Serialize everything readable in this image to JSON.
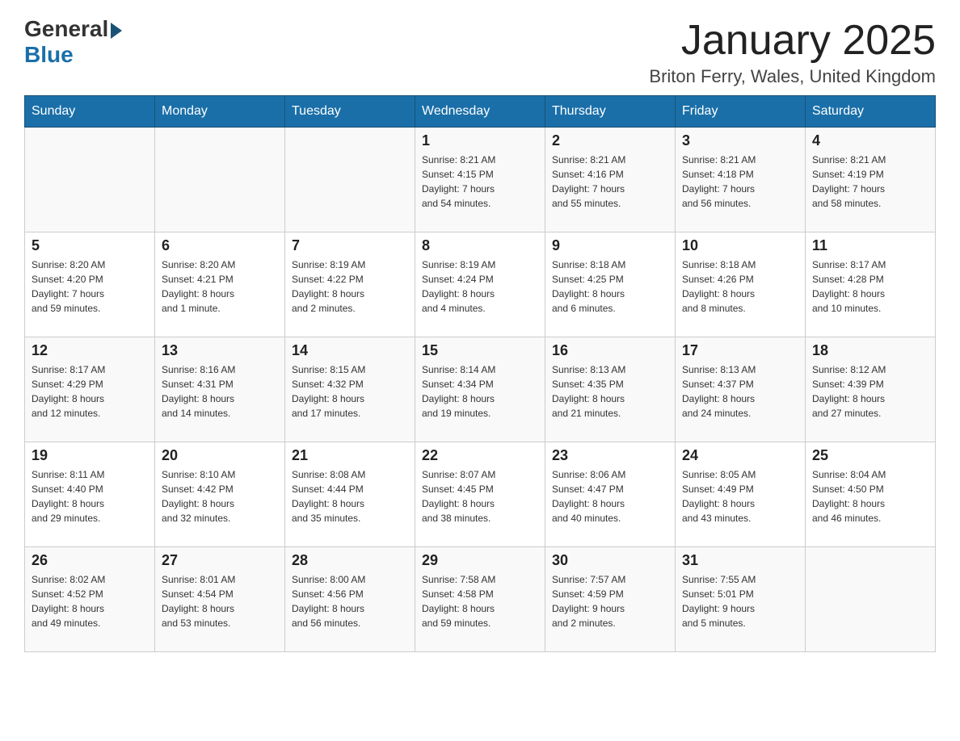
{
  "header": {
    "logo_general": "General",
    "logo_blue": "Blue",
    "title": "January 2025",
    "subtitle": "Briton Ferry, Wales, United Kingdom"
  },
  "days_of_week": [
    "Sunday",
    "Monday",
    "Tuesday",
    "Wednesday",
    "Thursday",
    "Friday",
    "Saturday"
  ],
  "weeks": [
    [
      {
        "day": "",
        "info": ""
      },
      {
        "day": "",
        "info": ""
      },
      {
        "day": "",
        "info": ""
      },
      {
        "day": "1",
        "info": "Sunrise: 8:21 AM\nSunset: 4:15 PM\nDaylight: 7 hours\nand 54 minutes."
      },
      {
        "day": "2",
        "info": "Sunrise: 8:21 AM\nSunset: 4:16 PM\nDaylight: 7 hours\nand 55 minutes."
      },
      {
        "day": "3",
        "info": "Sunrise: 8:21 AM\nSunset: 4:18 PM\nDaylight: 7 hours\nand 56 minutes."
      },
      {
        "day": "4",
        "info": "Sunrise: 8:21 AM\nSunset: 4:19 PM\nDaylight: 7 hours\nand 58 minutes."
      }
    ],
    [
      {
        "day": "5",
        "info": "Sunrise: 8:20 AM\nSunset: 4:20 PM\nDaylight: 7 hours\nand 59 minutes."
      },
      {
        "day": "6",
        "info": "Sunrise: 8:20 AM\nSunset: 4:21 PM\nDaylight: 8 hours\nand 1 minute."
      },
      {
        "day": "7",
        "info": "Sunrise: 8:19 AM\nSunset: 4:22 PM\nDaylight: 8 hours\nand 2 minutes."
      },
      {
        "day": "8",
        "info": "Sunrise: 8:19 AM\nSunset: 4:24 PM\nDaylight: 8 hours\nand 4 minutes."
      },
      {
        "day": "9",
        "info": "Sunrise: 8:18 AM\nSunset: 4:25 PM\nDaylight: 8 hours\nand 6 minutes."
      },
      {
        "day": "10",
        "info": "Sunrise: 8:18 AM\nSunset: 4:26 PM\nDaylight: 8 hours\nand 8 minutes."
      },
      {
        "day": "11",
        "info": "Sunrise: 8:17 AM\nSunset: 4:28 PM\nDaylight: 8 hours\nand 10 minutes."
      }
    ],
    [
      {
        "day": "12",
        "info": "Sunrise: 8:17 AM\nSunset: 4:29 PM\nDaylight: 8 hours\nand 12 minutes."
      },
      {
        "day": "13",
        "info": "Sunrise: 8:16 AM\nSunset: 4:31 PM\nDaylight: 8 hours\nand 14 minutes."
      },
      {
        "day": "14",
        "info": "Sunrise: 8:15 AM\nSunset: 4:32 PM\nDaylight: 8 hours\nand 17 minutes."
      },
      {
        "day": "15",
        "info": "Sunrise: 8:14 AM\nSunset: 4:34 PM\nDaylight: 8 hours\nand 19 minutes."
      },
      {
        "day": "16",
        "info": "Sunrise: 8:13 AM\nSunset: 4:35 PM\nDaylight: 8 hours\nand 21 minutes."
      },
      {
        "day": "17",
        "info": "Sunrise: 8:13 AM\nSunset: 4:37 PM\nDaylight: 8 hours\nand 24 minutes."
      },
      {
        "day": "18",
        "info": "Sunrise: 8:12 AM\nSunset: 4:39 PM\nDaylight: 8 hours\nand 27 minutes."
      }
    ],
    [
      {
        "day": "19",
        "info": "Sunrise: 8:11 AM\nSunset: 4:40 PM\nDaylight: 8 hours\nand 29 minutes."
      },
      {
        "day": "20",
        "info": "Sunrise: 8:10 AM\nSunset: 4:42 PM\nDaylight: 8 hours\nand 32 minutes."
      },
      {
        "day": "21",
        "info": "Sunrise: 8:08 AM\nSunset: 4:44 PM\nDaylight: 8 hours\nand 35 minutes."
      },
      {
        "day": "22",
        "info": "Sunrise: 8:07 AM\nSunset: 4:45 PM\nDaylight: 8 hours\nand 38 minutes."
      },
      {
        "day": "23",
        "info": "Sunrise: 8:06 AM\nSunset: 4:47 PM\nDaylight: 8 hours\nand 40 minutes."
      },
      {
        "day": "24",
        "info": "Sunrise: 8:05 AM\nSunset: 4:49 PM\nDaylight: 8 hours\nand 43 minutes."
      },
      {
        "day": "25",
        "info": "Sunrise: 8:04 AM\nSunset: 4:50 PM\nDaylight: 8 hours\nand 46 minutes."
      }
    ],
    [
      {
        "day": "26",
        "info": "Sunrise: 8:02 AM\nSunset: 4:52 PM\nDaylight: 8 hours\nand 49 minutes."
      },
      {
        "day": "27",
        "info": "Sunrise: 8:01 AM\nSunset: 4:54 PM\nDaylight: 8 hours\nand 53 minutes."
      },
      {
        "day": "28",
        "info": "Sunrise: 8:00 AM\nSunset: 4:56 PM\nDaylight: 8 hours\nand 56 minutes."
      },
      {
        "day": "29",
        "info": "Sunrise: 7:58 AM\nSunset: 4:58 PM\nDaylight: 8 hours\nand 59 minutes."
      },
      {
        "day": "30",
        "info": "Sunrise: 7:57 AM\nSunset: 4:59 PM\nDaylight: 9 hours\nand 2 minutes."
      },
      {
        "day": "31",
        "info": "Sunrise: 7:55 AM\nSunset: 5:01 PM\nDaylight: 9 hours\nand 5 minutes."
      },
      {
        "day": "",
        "info": ""
      }
    ]
  ]
}
